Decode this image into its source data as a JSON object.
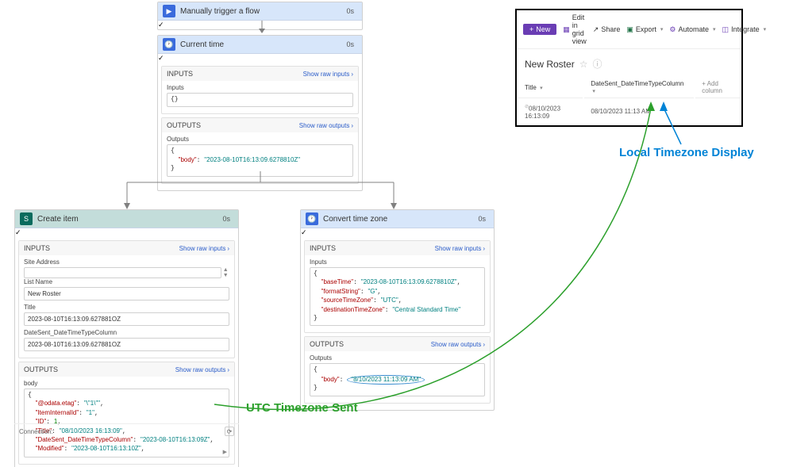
{
  "trigger": {
    "title": "Manually trigger a flow",
    "dur": "0s"
  },
  "curtime": {
    "title": "Current time",
    "dur": "0s",
    "inputsHdr": "INPUTS",
    "rawIn": "Show raw inputs",
    "inLbl": "Inputs",
    "inVal": "{}",
    "outputsHdr": "OUTPUTS",
    "rawOut": "Show raw outputs",
    "outLbl": "Outputs",
    "outBody": "  \"body\": \"2023-08-10T16:13:09.6278810Z\""
  },
  "create": {
    "title": "Create item",
    "dur": "0s",
    "inputsHdr": "INPUTS",
    "rawIn": "Show raw inputs",
    "siteLbl": "Site Address",
    "listLbl": "List Name",
    "listVal": "New Roster",
    "titleLbl": "Title",
    "titleVal": "2023-08-10T16:13:09.627881OZ",
    "dateLbl": "DateSent_DateTimeTypeColumn",
    "dateVal": "2023-08-10T16:13:09.627881OZ",
    "outputsHdr": "OUTPUTS",
    "rawOut": "Show raw outputs",
    "bodyLbl": "body",
    "l1": "\"@odata.etag\": \"\\\"1\\\"\",",
    "l2": "\"ItemInternalId\": \"1\",",
    "l3": "\"ID\": 1,",
    "l4": "\"Title\": \"08/10/2023 16:13:09\",",
    "l5": "\"DateSent_DateTimeTypeColumn\": \"2023-08-10T16:13:09Z\",",
    "l6": "\"Modified\": \"2023-08-10T16:13:10Z\",",
    "conn": "Connection:"
  },
  "convert": {
    "title": "Convert time zone",
    "dur": "0s",
    "inputsHdr": "INPUTS",
    "rawIn": "Show raw inputs",
    "inLbl": "Inputs",
    "l1": "\"baseTime\": \"2023-08-10T16:13:09.6278810Z\",",
    "l2": "\"formatString\": \"G\",",
    "l3": "\"sourceTimeZone\": \"UTC\",",
    "l4": "\"destinationTimeZone\": \"Central Standard Time\"",
    "outputsHdr": "OUTPUTS",
    "rawOut": "Show raw outputs",
    "outLbl": "Outputs",
    "outBody": "\"body\": ",
    "outVal": "\"8/10/2023 11:13:09 AM\""
  },
  "sp": {
    "new": "New",
    "grid": "Edit in grid view",
    "share": "Share",
    "export": "Export",
    "automate": "Automate",
    "integrate": "Integrate",
    "listTitle": "New Roster",
    "colTitle": "Title",
    "colDate": "DateSent_DateTimeTypeColumn",
    "colAdd": "Add column",
    "row1Title": "08/10/2023 16:13:09",
    "row1Date": "08/10/2023 11:13 AM"
  },
  "annGreen": "UTC Timezone Sent",
  "annBlue": "Local Timezone Display"
}
